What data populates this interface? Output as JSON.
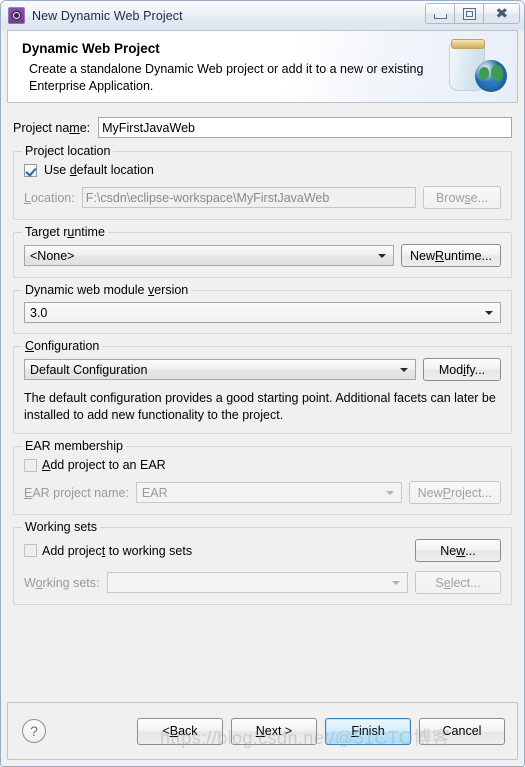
{
  "window": {
    "title": "New Dynamic Web Project",
    "icon": "eclipse-wizard-icon",
    "controls": {
      "minimize": "Minimize",
      "maximize": "Maximize",
      "close": "Close"
    }
  },
  "banner": {
    "title": "Dynamic Web Project",
    "description": "Create a standalone Dynamic Web project or add it to a new or existing Enterprise Application.",
    "art": "jar-globe-icon"
  },
  "project_name": {
    "label": "Project name:",
    "value": "MyFirstJavaWeb",
    "placeholder": ""
  },
  "project_location": {
    "group_title": "Project location",
    "use_default_label": "Use default location",
    "use_default_checked": true,
    "location_label": "Location:",
    "location_value": "F:\\csdn\\eclipse-workspace\\MyFirstJavaWeb",
    "browse_label": "Browse...",
    "browse_enabled": false
  },
  "target_runtime": {
    "group_title": "Target runtime",
    "selected": "<None>",
    "new_runtime_label": "New Runtime..."
  },
  "module_version": {
    "group_title": "Dynamic web module version",
    "selected": "3.0"
  },
  "configuration": {
    "group_title": "Configuration",
    "selected": "Default Configuration",
    "modify_label": "Modify...",
    "help_text": "The default configuration provides a good starting point. Additional facets can later be installed to add new functionality to the project."
  },
  "ear_membership": {
    "group_title": "EAR membership",
    "add_to_ear_label": "Add project to an EAR",
    "add_to_ear_checked": false,
    "ear_name_label": "EAR project name:",
    "ear_name_value": "EAR",
    "new_project_label": "New Project...",
    "enabled": false
  },
  "working_sets": {
    "group_title": "Working sets",
    "add_to_working_sets_label": "Add project to working sets",
    "add_to_working_sets_checked": false,
    "working_sets_label": "Working sets:",
    "working_sets_value": "",
    "new_label": "New...",
    "select_label": "Select...",
    "select_enabled": false
  },
  "footer": {
    "help_icon": "?",
    "back_label": "< Back",
    "next_label": "Next >",
    "finish_label": "Finish",
    "cancel_label": "Cancel",
    "default_button": "Finish"
  },
  "watermark": {
    "text": "https://blog.csdn.net/@51CTO博客"
  },
  "colors": {
    "accent": "#3c7fb1",
    "check": "#2a63b5",
    "window_bg": "#f0f0f0",
    "title_text": "#1b2b44",
    "disabled_text": "#9a9a9a"
  }
}
